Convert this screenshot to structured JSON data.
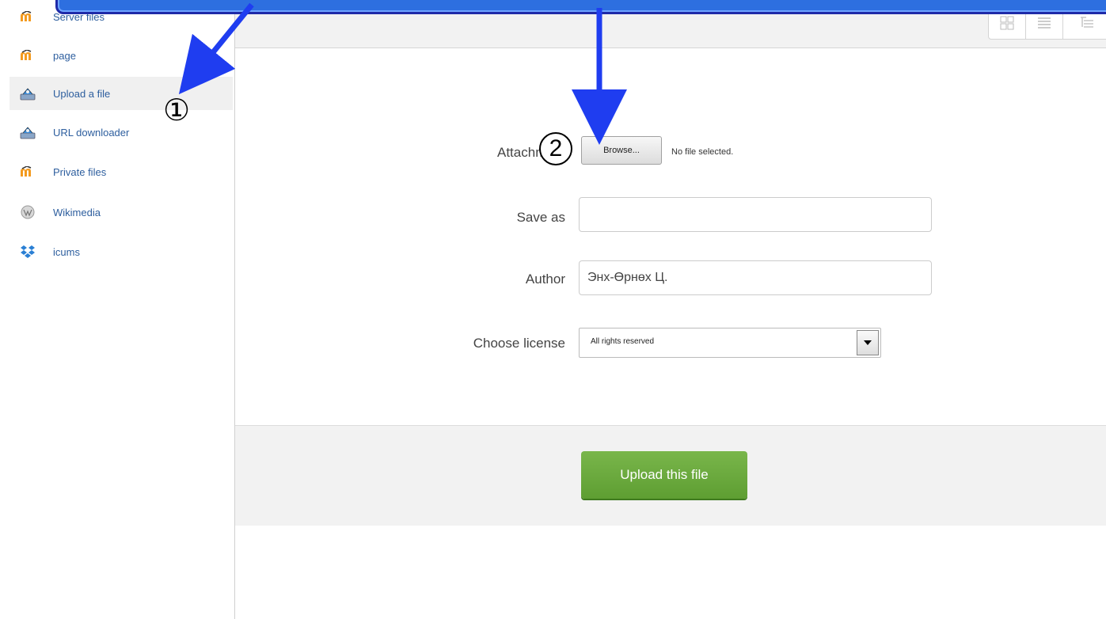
{
  "sidebar": {
    "items": [
      {
        "label": "Server files",
        "icon": "moodle-icon"
      },
      {
        "label": "page",
        "icon": "moodle-icon"
      },
      {
        "label": "Upload a file",
        "icon": "upload-icon"
      },
      {
        "label": "URL downloader",
        "icon": "upload-icon"
      },
      {
        "label": "Private files",
        "icon": "moodle-icon"
      },
      {
        "label": "Wikimedia",
        "icon": "wikimedia-icon"
      },
      {
        "label": "icums",
        "icon": "dropbox-icon"
      }
    ],
    "active_index": 2
  },
  "toolbar": {
    "view_icons": [
      "grid-view-icon",
      "list-view-icon",
      "tree-view-icon"
    ]
  },
  "form": {
    "attachment_label": "Attachment",
    "browse_label": "Browse...",
    "no_file_text": "No file selected.",
    "save_as_label": "Save as",
    "save_as_value": "",
    "author_label": "Author",
    "author_value": "Энх-Өрнөх Ц.",
    "license_label": "Choose license",
    "license_value": "All rights reserved"
  },
  "actions": {
    "upload_label": "Upload this file"
  },
  "annotations": {
    "marker_1": "①",
    "marker_2": "2"
  },
  "colors": {
    "link": "#2d5e9e",
    "upload_button": "#6aa84f",
    "annotation_arrow": "#1f3df0",
    "banner": "#2d6fe0"
  }
}
